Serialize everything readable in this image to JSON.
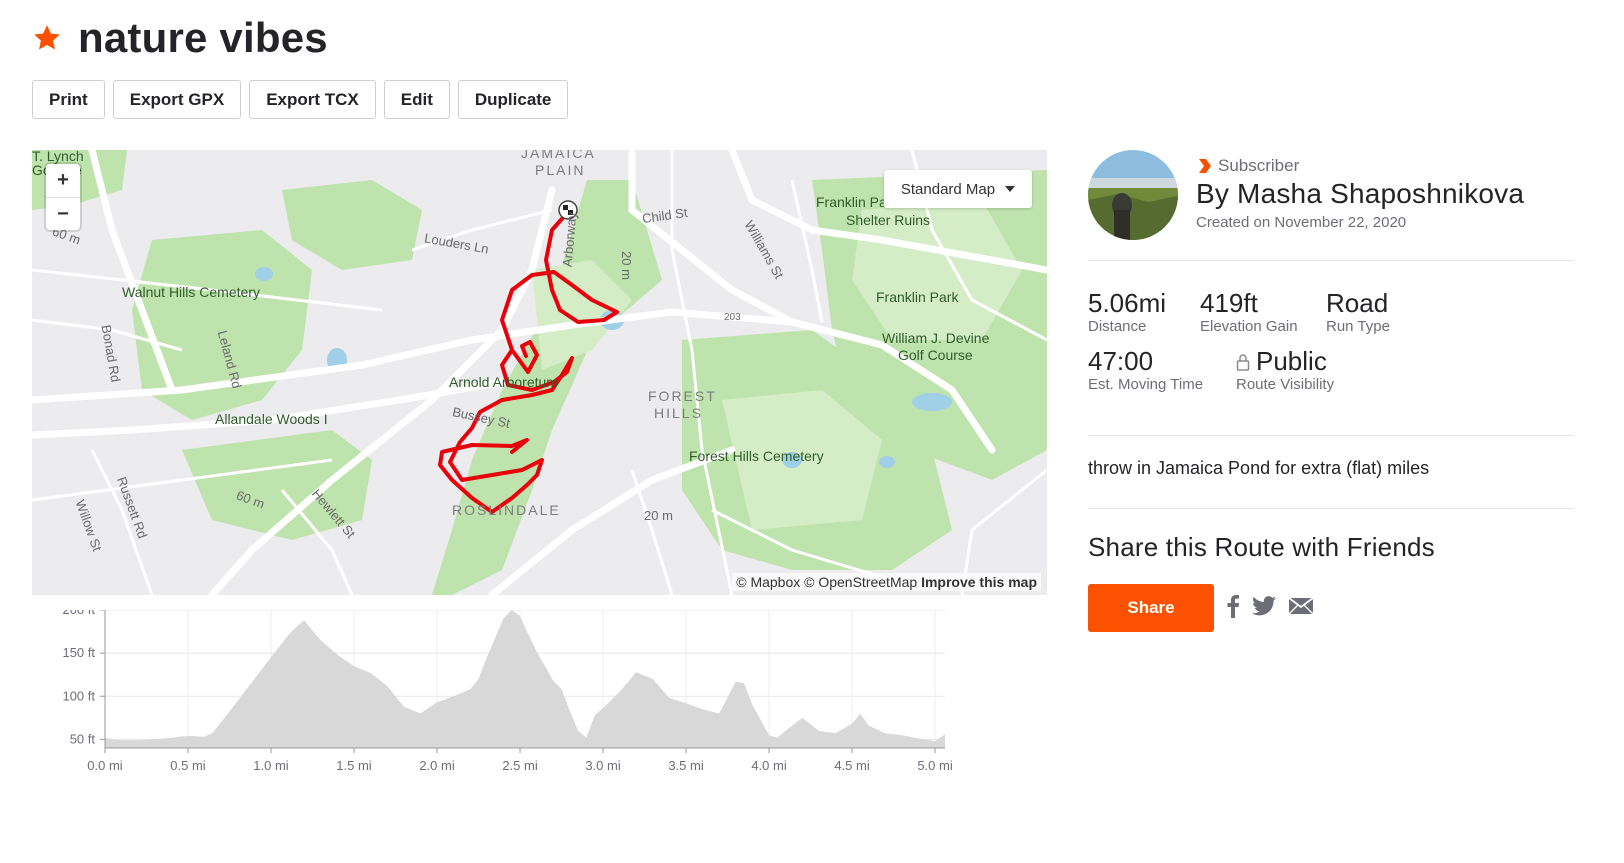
{
  "route": {
    "title": "nature vibes",
    "description": "throw in Jamaica Pond for extra (flat) miles"
  },
  "actions": [
    "Print",
    "Export GPX",
    "Export TCX",
    "Edit",
    "Duplicate"
  ],
  "map": {
    "style_label": "Standard Map",
    "zoom_in": "+",
    "zoom_out": "−",
    "attribution_1": "© Mapbox © OpenStreetMap",
    "attribution_2": "Improve this map",
    "labels": {
      "lynch": "T. Lynch",
      "golf1": "Go  urse",
      "jamaica": "JAMAICA",
      "plain": "PLAIN",
      "franklin_overlook": "Franklin Park Overlook",
      "shelter": "Shelter Ruins",
      "child_st": "Child St",
      "williams_st": "Williams St",
      "louders": "Louders Ln",
      "arborway": "Arborway",
      "walnut": "Walnut Hills Cemetery",
      "franklin_park": "Franklin Park",
      "devine1": "William J. Devine",
      "devine2": "Golf Course",
      "bonad": "Bonad Rd",
      "leland": "Leland Rd",
      "arnold": "Arnold Arboretum",
      "forest1": "FOREST",
      "forest2": "HILLS",
      "allandale": "Allandale Woods I",
      "bussey": "Bussey St",
      "forest_cem": "Forest Hills Cemetery",
      "russett": "Russett Rd",
      "hewlett": "Hewlett St",
      "roslindale": "ROSLINDALE",
      "willow": "Willow St",
      "m60a": "60 m",
      "m60b": "60 m",
      "m20a": "20 m",
      "m20b": "20 m",
      "r203": "203"
    }
  },
  "owner": {
    "badge": "Subscriber",
    "byline": "By Masha Shaposhnikova",
    "created": "Created on November 22, 2020"
  },
  "stats": {
    "distance": {
      "value": "5.06mi",
      "label": "Distance"
    },
    "elevation": {
      "value": "419ft",
      "label": "Elevation Gain"
    },
    "type": {
      "value": "Road",
      "label": "Run Type"
    },
    "time": {
      "value": "47:00",
      "label": "Est. Moving Time"
    },
    "visibility": {
      "value": "Public",
      "label": "Route Visibility"
    }
  },
  "share": {
    "heading": "Share this Route with Friends",
    "button": "Share"
  },
  "colors": {
    "accent": "#fc5200",
    "route": "#e8000b",
    "park": "#b9e2a6",
    "water": "#9fd0e8",
    "area_fill": "#d8d8d8"
  },
  "icons": [
    "star-icon",
    "subscriber-chevron-icon",
    "lock-icon",
    "facebook-icon",
    "twitter-icon",
    "email-icon",
    "finish-flag-icon"
  ],
  "chart_data": {
    "type": "area",
    "title": "",
    "xlabel": "",
    "ylabel": "",
    "xlim": [
      0,
      5.06
    ],
    "ylim": [
      40,
      200
    ],
    "x_ticks": [
      "0.0 mi",
      "0.5 mi",
      "1.0 mi",
      "1.5 mi",
      "2.0 mi",
      "2.5 mi",
      "3.0 mi",
      "3.5 mi",
      "4.0 mi",
      "4.5 mi",
      "5.0 mi"
    ],
    "y_ticks": [
      "50 ft",
      "100 ft",
      "150 ft",
      "200 ft"
    ],
    "grid": true,
    "x": [
      0,
      0.05,
      0.1,
      0.2,
      0.3,
      0.4,
      0.5,
      0.6,
      0.65,
      0.7,
      0.8,
      0.9,
      1.0,
      1.1,
      1.15,
      1.2,
      1.25,
      1.3,
      1.4,
      1.5,
      1.6,
      1.7,
      1.8,
      1.9,
      2.0,
      2.1,
      2.2,
      2.25,
      2.3,
      2.4,
      2.45,
      2.5,
      2.55,
      2.6,
      2.7,
      2.75,
      2.8,
      2.85,
      2.9,
      2.95,
      3.0,
      3.1,
      3.2,
      3.3,
      3.4,
      3.5,
      3.6,
      3.7,
      3.8,
      3.85,
      3.9,
      4.0,
      4.05,
      4.1,
      4.2,
      4.3,
      4.4,
      4.5,
      4.55,
      4.6,
      4.7,
      4.8,
      4.9,
      5.0,
      5.06
    ],
    "series": [
      {
        "values": [
          52,
          50,
          49,
          49,
          50,
          52,
          54,
          53,
          58,
          70,
          95,
          120,
          145,
          170,
          180,
          188,
          176,
          165,
          148,
          135,
          127,
          112,
          88,
          80,
          93,
          100,
          108,
          120,
          145,
          190,
          200,
          193,
          172,
          152,
          118,
          108,
          83,
          60,
          52,
          78,
          86,
          105,
          128,
          120,
          98,
          92,
          85,
          80,
          117,
          115,
          90,
          55,
          52,
          60,
          75,
          60,
          57,
          68,
          80,
          66,
          57,
          55,
          51,
          48,
          56
        ]
      }
    ]
  }
}
